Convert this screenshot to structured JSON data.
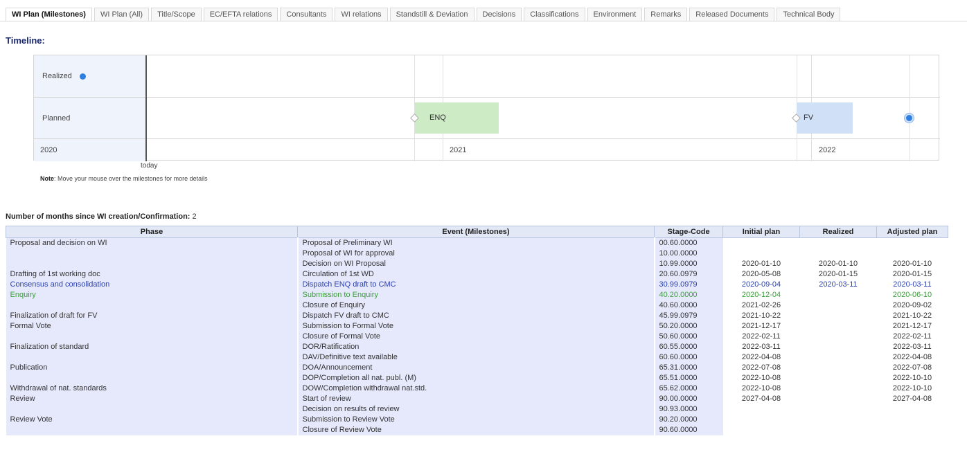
{
  "tabs": [
    {
      "label": "WI Plan (Milestones)",
      "active": true
    },
    {
      "label": "WI Plan (All)"
    },
    {
      "label": "Title/Scope"
    },
    {
      "label": "EC/EFTA relations"
    },
    {
      "label": "Consultants"
    },
    {
      "label": "WI relations"
    },
    {
      "label": "Standstill & Deviation"
    },
    {
      "label": "Decisions"
    },
    {
      "label": "Classifications"
    },
    {
      "label": "Environment"
    },
    {
      "label": "Remarks"
    },
    {
      "label": "Released Documents"
    },
    {
      "label": "Technical Body"
    }
  ],
  "heading": "Timeline:",
  "timeline": {
    "row_realized": "Realized",
    "row_planned": "Planned",
    "years": [
      "2020",
      "2021",
      "2022"
    ],
    "bar_enq": "ENQ",
    "bar_fv": "FV",
    "today_label": "today",
    "colors": {
      "enq_bar": "#cdebc4",
      "fv_bar": "#cfe0f7",
      "milestone_dot": "#2f7fe0"
    }
  },
  "note": {
    "prefix": "Note",
    "text": ": Move your mouse over the milestones for more details"
  },
  "months": {
    "label": "Number of months since WI creation/Confirmation:",
    "value": " 2"
  },
  "table": {
    "headers": {
      "phase": "Phase",
      "event": "Event (Milestones)",
      "code": "Stage-Code",
      "initial": "Initial plan",
      "realized": "Realized",
      "adjusted": "Adjusted plan"
    },
    "rows": [
      {
        "phase": "Proposal and decision on WI",
        "event": "Proposal of Preliminary WI",
        "code": "00.60.0000",
        "initial": "",
        "realized": "",
        "adjusted": ""
      },
      {
        "phase": "",
        "event": "Proposal of WI for approval",
        "code": "10.00.0000",
        "initial": "",
        "realized": "",
        "adjusted": ""
      },
      {
        "phase": "",
        "event": "Decision on WI Proposal",
        "code": "10.99.0000",
        "initial": "2020-01-10",
        "realized": "2020-01-10",
        "adjusted": "2020-01-10"
      },
      {
        "phase": "Drafting of 1st working doc",
        "event": "Circulation of 1st WD",
        "code": "20.60.0979",
        "initial": "2020-05-08",
        "realized": "2020-01-15",
        "adjusted": "2020-01-15"
      },
      {
        "phase": "Consensus and consolidation",
        "event": "Dispatch ENQ draft to CMC",
        "code": "30.99.0979",
        "initial": "2020-09-04",
        "realized": "2020-03-11",
        "adjusted": "2020-03-11",
        "style": "blue"
      },
      {
        "phase": "Enquiry",
        "event": "Submission to Enquiry",
        "code": "40.20.0000",
        "initial": "2020-12-04",
        "realized": "",
        "adjusted": "2020-06-10",
        "style": "green",
        "phase_indent": true,
        "event_indent": true
      },
      {
        "phase": "",
        "event": "Closure of Enquiry",
        "code": "40.60.0000",
        "initial": "2021-02-26",
        "realized": "",
        "adjusted": "2020-09-02",
        "event_indent": true
      },
      {
        "phase": "Finalization of draft for FV",
        "event": "Dispatch FV draft to CMC",
        "code": "45.99.0979",
        "initial": "2021-10-22",
        "realized": "",
        "adjusted": "2021-10-22"
      },
      {
        "phase": "Formal Vote",
        "event": "Submission to Formal Vote",
        "code": "50.20.0000",
        "initial": "2021-12-17",
        "realized": "",
        "adjusted": "2021-12-17",
        "phase_indent": true,
        "event_indent": true
      },
      {
        "phase": "",
        "event": "Closure of Formal Vote",
        "code": "50.60.0000",
        "initial": "2022-02-11",
        "realized": "",
        "adjusted": "2022-02-11",
        "event_indent": true
      },
      {
        "phase": "Finalization of standard",
        "event": "DOR/Ratification",
        "code": "60.55.0000",
        "initial": "2022-03-11",
        "realized": "",
        "adjusted": "2022-03-11"
      },
      {
        "phase": "",
        "event": "DAV/Definitive text available",
        "code": "60.60.0000",
        "initial": "2022-04-08",
        "realized": "",
        "adjusted": "2022-04-08"
      },
      {
        "phase": "Publication",
        "event": "DOA/Announcement",
        "code": "65.31.0000",
        "initial": "2022-07-08",
        "realized": "",
        "adjusted": "2022-07-08",
        "phase_indent": true,
        "event_indent": true
      },
      {
        "phase": "",
        "event": "DOP/Completion all nat. publ. (M)",
        "code": "65.51.0000",
        "initial": "2022-10-08",
        "realized": "",
        "adjusted": "2022-10-10",
        "event_indent": true
      },
      {
        "phase": "Withdrawal of nat. standards",
        "event": "DOW/Completion withdrawal nat.std.",
        "code": "65.62.0000",
        "initial": "2022-10-08",
        "realized": "",
        "adjusted": "2022-10-10",
        "phase_indent": true,
        "event_indent": true
      },
      {
        "phase": "Review",
        "event": "Start of review",
        "code": "90.00.0000",
        "initial": "2027-04-08",
        "realized": "",
        "adjusted": "2027-04-08"
      },
      {
        "phase": "",
        "event": "Decision on results of review",
        "code": "90.93.0000",
        "initial": "",
        "realized": "",
        "adjusted": ""
      },
      {
        "phase": "Review Vote",
        "event": "Submission to Review Vote",
        "code": "90.20.0000",
        "initial": "",
        "realized": "",
        "adjusted": "",
        "phase_indent": true,
        "event_indent": true
      },
      {
        "phase": "",
        "event": "Closure of Review Vote",
        "code": "90.60.0000",
        "initial": "",
        "realized": "",
        "adjusted": "",
        "event_indent": true
      }
    ]
  }
}
